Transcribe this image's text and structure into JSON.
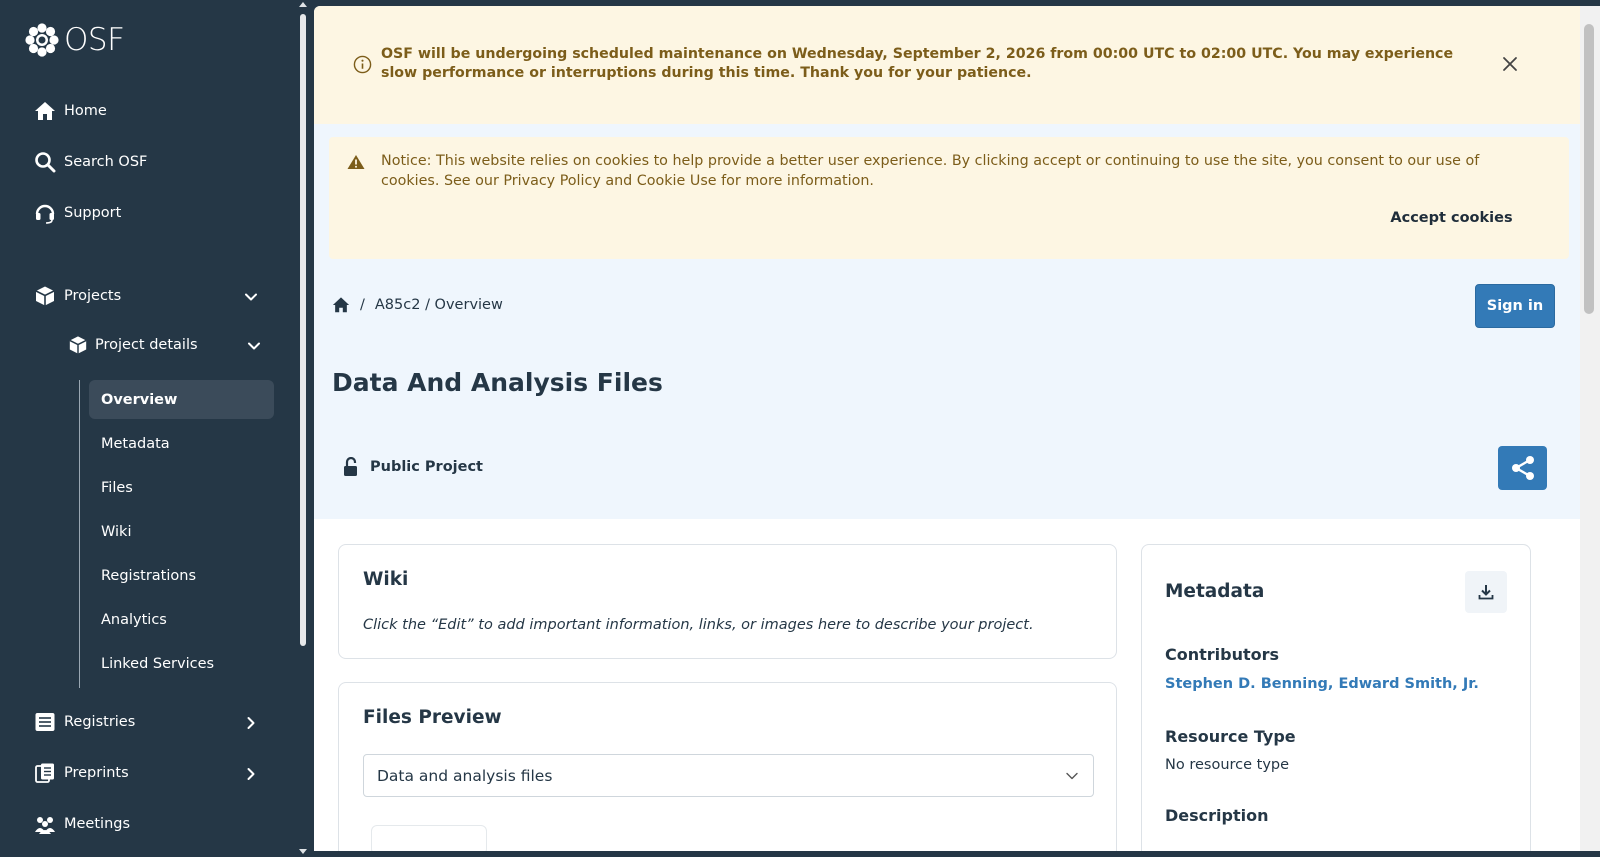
{
  "brand": {
    "name": "OSF"
  },
  "sidebar": {
    "nav": [
      {
        "label": "Home",
        "icon": "home-icon"
      },
      {
        "label": "Search OSF",
        "icon": "search-icon"
      },
      {
        "label": "Support",
        "icon": "headset-icon"
      }
    ],
    "projects": {
      "label": "Projects",
      "icon": "cube-icon"
    },
    "project_details": {
      "label": "Project details",
      "icon": "cube-icon"
    },
    "project_pages": [
      "Overview",
      "Metadata",
      "Files",
      "Wiki",
      "Registrations",
      "Analytics",
      "Linked Services"
    ],
    "active_page": "Overview",
    "registries": {
      "label": "Registries",
      "icon": "registries-icon"
    },
    "preprints": {
      "label": "Preprints",
      "icon": "preprints-icon"
    },
    "meetings": {
      "label": "Meetings",
      "icon": "meetings-icon"
    }
  },
  "maintenance_banner": {
    "message": "OSF will be undergoing scheduled maintenance on Wednesday, September 2, 2026 from 00:00 UTC to 02:00 UTC. You may experience slow performance or interruptions during this time. Thank you for your patience."
  },
  "cookie_notice": {
    "message": "Notice: This website relies on cookies to help provide a better user experience. By clicking accept or continuing to use the site, you consent to our use of cookies. See our Privacy Policy and Cookie Use for more information.",
    "accept_label": "Accept cookies"
  },
  "breadcrumb": {
    "separator": "/",
    "path": "A85c2 / Overview"
  },
  "header": {
    "signin_label": "Sign in",
    "title": "Data And Analysis Files",
    "visibility": "Public Project"
  },
  "wiki": {
    "title": "Wiki",
    "placeholder_text": "Click the “Edit” to add important information, links, or images here to describe your project."
  },
  "files_preview": {
    "title": "Files Preview",
    "selected": "Data and analysis files"
  },
  "metadata": {
    "title": "Metadata",
    "contributors_label": "Contributors",
    "contributors": "Stephen D. Benning, Edward Smith, Jr.",
    "resource_type_label": "Resource Type",
    "resource_type": "No resource type",
    "description_label": "Description"
  },
  "colors": {
    "sidebar_bg": "#253746",
    "accent": "#337ab7",
    "warning_bg": "#fdf6e3",
    "warning_text": "#7c5d1a",
    "main_bg": "#eff6fd"
  }
}
